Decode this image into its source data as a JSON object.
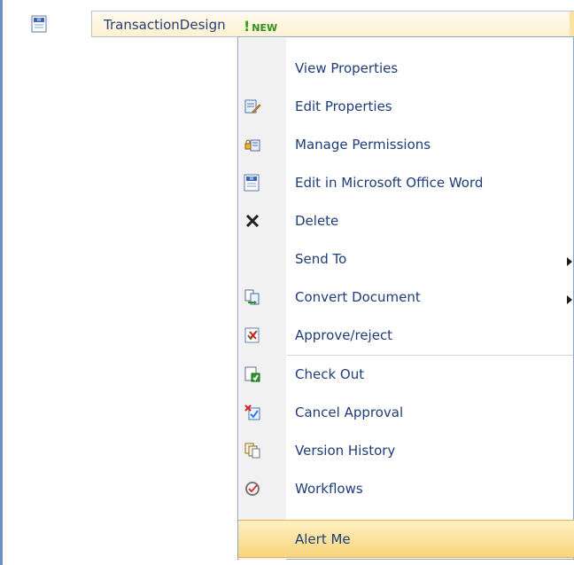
{
  "document": {
    "title": "TransactionDesign",
    "new_badge": "NEW"
  },
  "menu": {
    "items": [
      {
        "label": "View Properties",
        "icon": "view-properties-icon",
        "submenu": false
      },
      {
        "label": "Edit Properties",
        "icon": "edit-properties-icon",
        "submenu": false
      },
      {
        "label": "Manage Permissions",
        "icon": "manage-permissions-icon",
        "submenu": false
      },
      {
        "label": "Edit in Microsoft Office Word",
        "icon": "word-document-icon",
        "submenu": false
      },
      {
        "label": "Delete",
        "icon": "delete-icon",
        "submenu": false
      },
      {
        "label": "Send To",
        "icon": "send-to-icon",
        "submenu": true
      },
      {
        "label": "Convert Document",
        "icon": "convert-document-icon",
        "submenu": true
      },
      {
        "label": "Approve/reject",
        "icon": "approve-reject-icon",
        "submenu": false
      },
      {
        "label": "Check Out",
        "icon": "check-out-icon",
        "submenu": false
      },
      {
        "label": "Cancel Approval",
        "icon": "cancel-approval-icon",
        "submenu": false
      },
      {
        "label": "Version History",
        "icon": "version-history-icon",
        "submenu": false
      },
      {
        "label": "Workflows",
        "icon": "workflows-icon",
        "submenu": false
      },
      {
        "label": "Alert Me",
        "icon": "alert-me-icon",
        "submenu": false,
        "highlighted": true
      }
    ]
  },
  "colors": {
    "link_text": "#1f3d78",
    "highlight": "#f7d57c",
    "new_badge": "#2f8f1f"
  }
}
